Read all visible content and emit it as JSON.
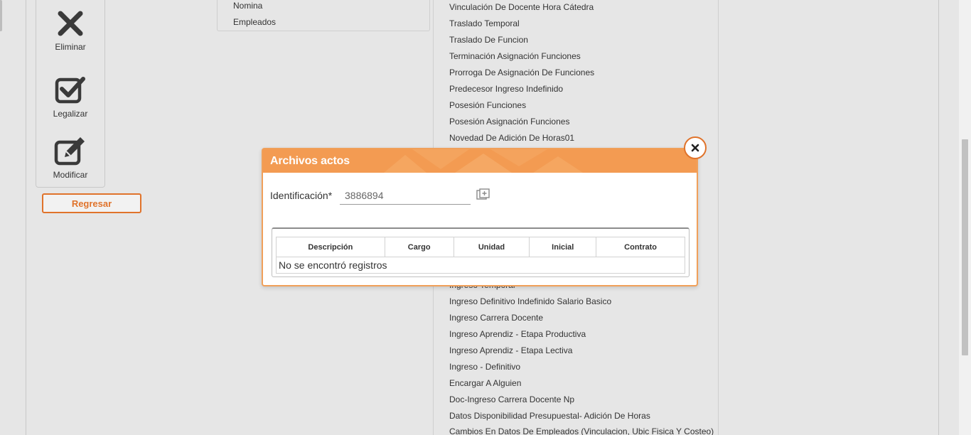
{
  "toolbar": {
    "eliminar": "Eliminar",
    "legalizar": "Legalizar",
    "modificar": "Modificar"
  },
  "regresar_label": "Regresar",
  "menu": {
    "items": [
      "Nomina",
      "Empleados"
    ]
  },
  "list": {
    "items": [
      "Vinculación De Docente Hora Cátedra",
      "Traslado Temporal",
      "Traslado De Funcion",
      "Terminación Asignación Funciones",
      "Prorroga De Asignación De Funciones",
      "Predecesor Ingreso Indefinido",
      "Posesión Funciones",
      "Posesión Asignación Funciones",
      "Novedad De Adición De Horas01",
      "Ingreso Temporal",
      "Ingreso Definitivo Indefinido Salario Basico",
      "Ingreso Carrera Docente",
      "Ingreso Aprendiz - Etapa Productiva",
      "Ingreso Aprendiz - Etapa Lectiva",
      "Ingreso - Definitivo",
      "Encargar A Alguien",
      "Doc-Ingreso Carrera Docente Np",
      "Datos Disponibilidad Presupuestal- Adición De Horas",
      "Cambios En Datos De Empleados (Vinculacion, Ubic Fisica Y Costeo)"
    ]
  },
  "modal": {
    "title": "Archivos actos",
    "id_label": "Identificación*",
    "id_value": "3886894",
    "table": {
      "headers": [
        "Descripción",
        "Cargo",
        "Unidad",
        "Inicial",
        "Contrato"
      ],
      "empty_message": "No se encontró registros"
    }
  },
  "colors": {
    "accent": "#e0732b",
    "header": "#f39b52",
    "background": "#e6e6e6"
  }
}
